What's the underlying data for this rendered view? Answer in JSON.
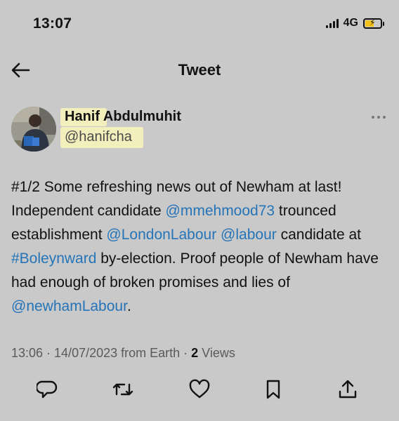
{
  "status_bar": {
    "time": "13:07",
    "network": "4G",
    "battery_fill_fraction": 0.55,
    "battery_color": "#f2c21a"
  },
  "header": {
    "title": "Tweet",
    "back_icon": "arrow-left-icon"
  },
  "author": {
    "display_name": "Hanif Abdulmuhit",
    "handle": "@hanifcha",
    "more_icon": "more-horizontal-icon"
  },
  "tweet": {
    "segments": [
      {
        "text": "#1/2 Some refreshing news out of Newham at last! Independent candidate ",
        "link": false
      },
      {
        "text": "@mmehmood73",
        "link": true
      },
      {
        "text": " trounced establishment ",
        "link": false
      },
      {
        "text": "@LondonLabour",
        "link": true
      },
      {
        "text": " ",
        "link": false
      },
      {
        "text": "@labour",
        "link": true
      },
      {
        "text": " candidate at ",
        "link": false
      },
      {
        "text": "#Boleynward",
        "link": true
      },
      {
        "text": " by-election. Proof people of Newham have had enough of broken promises and lies of ",
        "link": false
      },
      {
        "text": "@newhamLabour",
        "link": true
      },
      {
        "text": ".",
        "link": false
      }
    ],
    "link_color": "#2574b8"
  },
  "meta": {
    "timestamp": "13:06 · 14/07/2023 from Earth · ",
    "views_count": "2",
    "views_label": " Views"
  },
  "actions": [
    {
      "name": "reply-button",
      "icon": "reply-icon"
    },
    {
      "name": "retweet-button",
      "icon": "retweet-icon"
    },
    {
      "name": "like-button",
      "icon": "heart-icon"
    },
    {
      "name": "bookmark-button",
      "icon": "bookmark-icon"
    },
    {
      "name": "share-button",
      "icon": "share-icon"
    }
  ],
  "colors": {
    "background": "#c9c9c9",
    "highlight": "#f3efbc"
  }
}
